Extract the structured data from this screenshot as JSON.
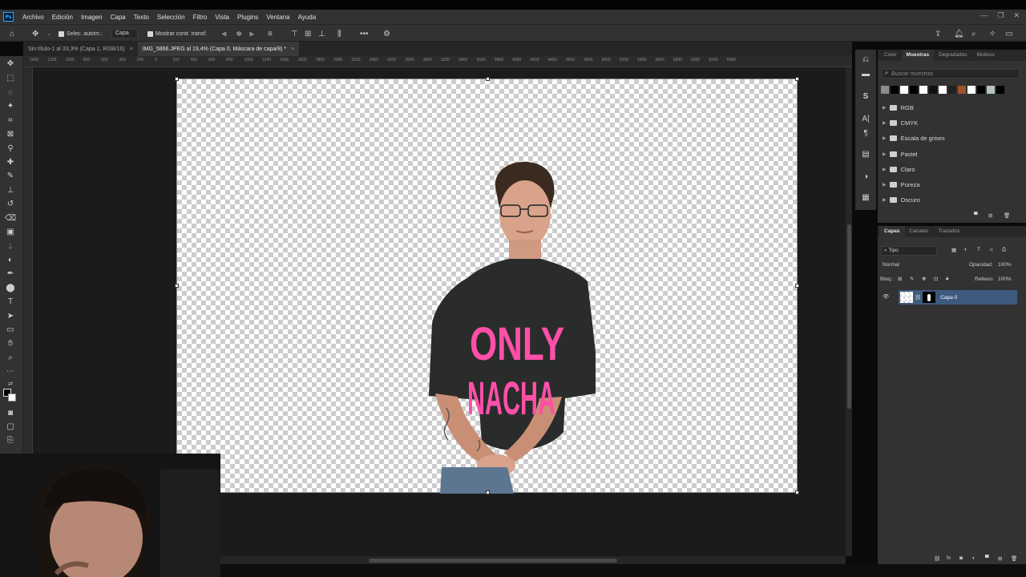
{
  "app": {
    "logo": "Ps",
    "menu": [
      "Archivo",
      "Edición",
      "Imagen",
      "Capa",
      "Texto",
      "Selección",
      "Filtro",
      "Vista",
      "Plugins",
      "Ventana",
      "Ayuda"
    ],
    "window_controls": [
      "—",
      "❐",
      "✕"
    ]
  },
  "options_bar": {
    "autoselect_label": "Selec. autom.:",
    "autoselect_value": "Capa",
    "show_transform_label": "Mostrar contr. transf."
  },
  "tabs": [
    {
      "label": "Sin título-1 al 33,3% (Capa 1, RGB/16)",
      "close": "×"
    },
    {
      "label": "IMG_5866.JPEG al 19,4% (Capa 0, Máscara de capa/8) *",
      "close": "×"
    }
  ],
  "ruler": {
    "ticks": [
      "1400",
      "1200",
      "1000",
      "800",
      "600",
      "400",
      "200",
      "0",
      "200",
      "400",
      "600",
      "800",
      "1000",
      "1200",
      "1400",
      "1600",
      "1800",
      "2000",
      "2200",
      "2400",
      "2600",
      "2800",
      "3000",
      "3200",
      "3400",
      "3600",
      "3800",
      "4000",
      "4200",
      "4400",
      "4600",
      "4800",
      "5000",
      "5200",
      "5400",
      "5600",
      "5800",
      "6000",
      "6200",
      "6400"
    ]
  },
  "canvas": {
    "shirt_text_line1": "ONLY",
    "shirt_text_line2": "NACHA"
  },
  "swatches_panel": {
    "tabs": [
      "Color",
      "Muestras",
      "Degradados",
      "Motivos"
    ],
    "search_placeholder": "Buscar muestras",
    "colors": [
      "#8c8c8c",
      "#000000",
      "#ffffff",
      "#000000",
      "#ffffff",
      "#111111",
      "#ffffff",
      "#222222",
      "#a0522d",
      "#ffffff",
      "#000000",
      "#b5c4c0",
      "#000000"
    ],
    "folders": [
      "RGB",
      "CMYK",
      "Escala de grises",
      "Pastel",
      "Claro",
      "Pureza",
      "Oscuro"
    ]
  },
  "layers_panel": {
    "tabs": [
      "Capas",
      "Canales",
      "Trazados"
    ],
    "filter_label": "Tipo",
    "blend_mode": "Normal",
    "opacity_label": "Opacidad:",
    "opacity_value": "100%",
    "lock_label": "Bloq.:",
    "fill_label": "Relleno:",
    "fill_value": "100%",
    "layers": [
      {
        "name": "Capa 0"
      }
    ]
  }
}
